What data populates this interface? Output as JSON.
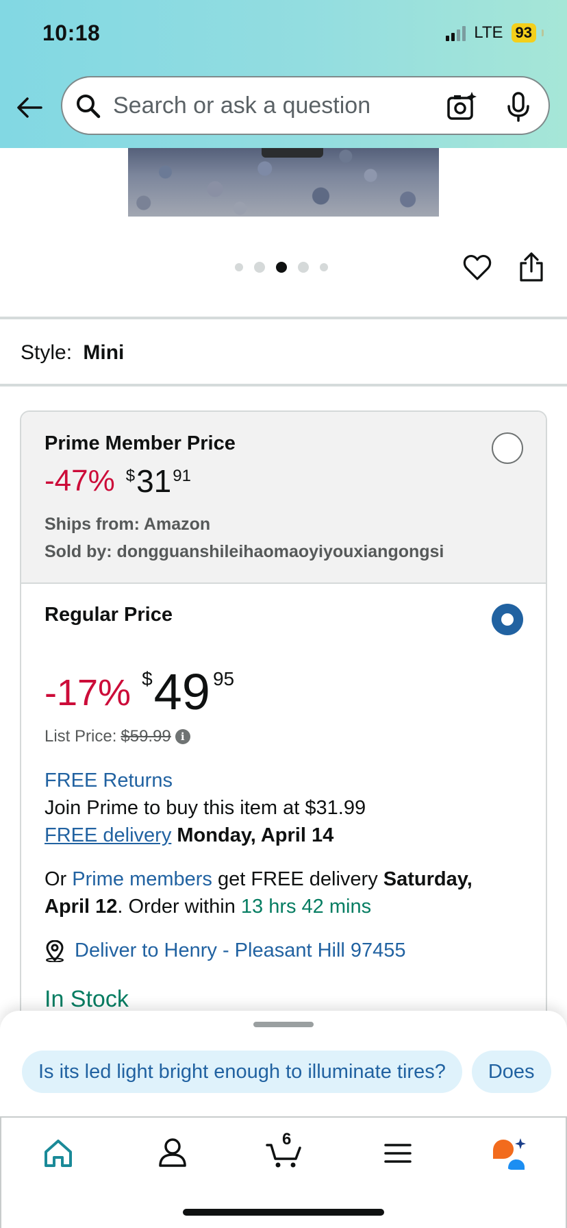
{
  "status_bar": {
    "time": "10:18",
    "network": "LTE",
    "battery": "93"
  },
  "search": {
    "placeholder": "Search or ask a question"
  },
  "product": {
    "style_label": "Style:",
    "style_value": "Mini",
    "image_count": 5,
    "active_image_index": 2
  },
  "prime_offer": {
    "title": "Prime Member Price",
    "discount": "-47%",
    "currency": "$",
    "price_whole": "31",
    "price_fraction": "91",
    "ships_from": "Ships from: Amazon",
    "sold_by": "Sold by: dongguanshileihaomaoyiyouxiangongsi",
    "selected": false
  },
  "regular_offer": {
    "title": "Regular Price",
    "discount": "-17%",
    "currency": "$",
    "price_whole": "49",
    "price_fraction": "95",
    "list_price_label": "List Price:",
    "list_price": "$59.99",
    "free_returns": "FREE Returns",
    "join_prime": "Join Prime to buy this item at $31.99",
    "free_delivery_link": "FREE delivery",
    "delivery_date": "Monday, April 14",
    "or_text": "Or ",
    "prime_members_link": "Prime members",
    "prime_delivery_text": " get FREE delivery ",
    "prime_delivery_date_1": "Saturday,",
    "prime_delivery_date_2": "April 12",
    "order_within_text": ". Order within ",
    "countdown": "13 hrs 42 mins",
    "deliver_to": "Deliver to Henry - Pleasant Hill 97455",
    "stock_status": "In Stock",
    "selected": true
  },
  "suggestions": [
    "Is its led light bright enough to illuminate tires?",
    "Does"
  ],
  "nav": {
    "cart_count": "6"
  },
  "colors": {
    "accent_blue": "#2162a1",
    "discount_red": "#cc0c39",
    "stock_green": "#067d62",
    "header_gradient_start": "#82d8e3",
    "header_gradient_end": "#a6e6d7"
  }
}
